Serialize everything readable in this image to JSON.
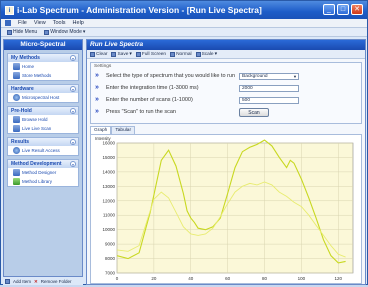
{
  "window": {
    "title": "i-Lab Spectrum - Administration Version - [Run Live Spectra]"
  },
  "menubar": {
    "items": [
      "File",
      "View",
      "Tools",
      "Help"
    ]
  },
  "toolbar": {
    "hide_menu": "Hide Menu",
    "window_mode": "Window Mode"
  },
  "sidebar": {
    "title": "Micro-Spectral",
    "groups": [
      {
        "title": "My Methods",
        "items": [
          "Home",
          "Store Methods"
        ]
      },
      {
        "title": "Hardware",
        "items": [
          "Microspectral Host"
        ]
      },
      {
        "title": "Pre-Hold",
        "items": [
          "Browse Hold",
          "Live Live Scan"
        ]
      },
      {
        "title": "Results",
        "items": [
          "Live Result Access"
        ]
      },
      {
        "title": "Method Development",
        "items": [
          "Method Designer",
          "Method Library"
        ]
      }
    ],
    "footer": {
      "add_label": "Add Item",
      "remove_label": "Remove Folder"
    }
  },
  "main": {
    "title": "Run Live Spectra",
    "toolbar": [
      "Clear",
      "Save",
      "Full Screen",
      "Normal",
      "Scale"
    ],
    "settings_label": "Settings",
    "rows": [
      "Select the type of spectrum that you would like to run",
      "Enter the integration time (1-3000 ms)",
      "Enter the number of scans (1-1000)",
      "Press \"Scan\" to run the scan"
    ],
    "spectrum_type": "Background",
    "integration_time": "2000",
    "num_scans": "500",
    "scan_button": "Scan",
    "tabs": [
      "Graph",
      "Tabular"
    ]
  },
  "chart_data": {
    "type": "line",
    "ylabel": "Intensity",
    "ylim": [
      7000,
      16000
    ],
    "xlim": [
      0,
      128
    ],
    "x_ticks": [
      0,
      20,
      40,
      60,
      80,
      100,
      120
    ],
    "y_ticks": [
      7000,
      8000,
      9000,
      10000,
      11000,
      12000,
      13000,
      14000,
      15000,
      16000
    ],
    "grid": true,
    "series": [
      {
        "color": "#c8d820",
        "x": [
          0,
          6,
          12,
          18,
          24,
          28,
          32,
          36,
          38,
          40,
          42,
          44,
          48,
          52,
          56,
          60,
          64,
          68,
          72,
          76,
          80,
          84,
          88,
          92,
          94,
          96,
          100,
          104,
          108,
          112,
          116,
          120,
          124
        ],
        "y": [
          8200,
          8000,
          8400,
          11200,
          14800,
          15500,
          14400,
          12500,
          11300,
          10800,
          10500,
          10100,
          10000,
          10200,
          10800,
          12500,
          14300,
          15400,
          15700,
          15900,
          16200,
          15800,
          15000,
          14300,
          14800,
          14600,
          13500,
          12200,
          10800,
          9300,
          8200,
          7700,
          7800
        ]
      },
      {
        "color": "#e8ec70",
        "x": [
          0,
          6,
          12,
          16,
          20,
          24,
          28,
          32,
          36,
          40,
          44,
          48,
          52,
          56,
          60,
          64,
          68,
          72,
          76,
          80,
          84,
          88,
          92,
          96,
          100,
          104,
          108,
          112,
          116,
          120,
          124
        ],
        "y": [
          8600,
          8500,
          8900,
          10500,
          12100,
          12600,
          12200,
          11200,
          10200,
          9700,
          9600,
          9700,
          10100,
          10900,
          11800,
          12600,
          13000,
          13200,
          13100,
          13300,
          13100,
          12600,
          12300,
          11900,
          11600,
          11000,
          10300,
          9600,
          8900,
          8300,
          8100
        ]
      }
    ]
  }
}
